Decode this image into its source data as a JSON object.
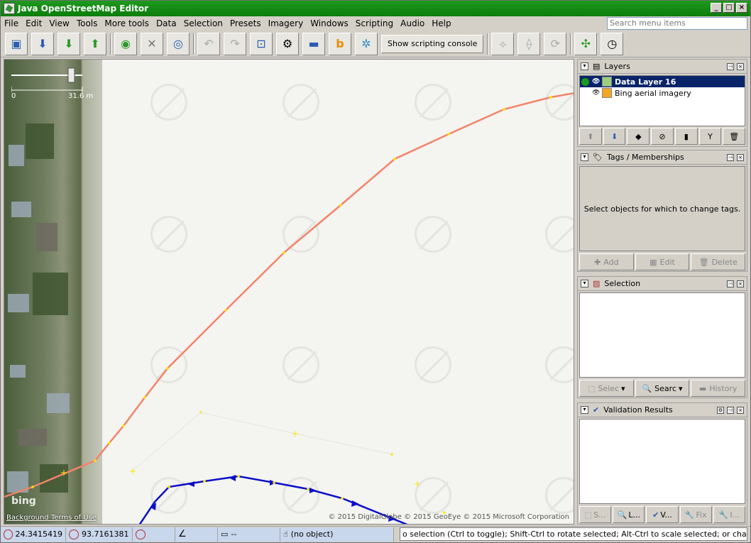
{
  "window": {
    "title": "Java OpenStreetMap Editor"
  },
  "menu": [
    "File",
    "Edit",
    "View",
    "Tools",
    "More tools",
    "Data",
    "Selection",
    "Presets",
    "Imagery",
    "Windows",
    "Scripting",
    "Audio",
    "Help"
  ],
  "search": {
    "placeholder": "Search menu items"
  },
  "toolbar": {
    "script_button_label": "Show scripting console",
    "buttons": [
      "open-icon",
      "save-icon",
      "download-icon",
      "upload-icon",
      "zoom-download-icon",
      "wireframe-icon",
      "search-area-icon",
      "undo-icon",
      "redo-icon",
      "zoom-extent-icon",
      "preferences-icon",
      "layer-swatch-icon",
      "bing-icon",
      "plugin-icon",
      "split-way-icon",
      "combine-way-icon",
      "refresh-icon",
      "zoom-fit-icon",
      "clock-icon"
    ]
  },
  "map": {
    "scale_label_start": "0",
    "scale_label_end": "31.6 m",
    "bing_logo": "bing",
    "attribution": "© 2015 DigitalGlobe © 2015 GeoEye © 2015 Microsoft Corporation",
    "background_terms": "Background Terms of Use"
  },
  "layers_panel": {
    "title": "Layers",
    "items": [
      {
        "label": "Data Layer 16",
        "selected": true
      },
      {
        "label": "Bing aerial imagery",
        "selected": false
      }
    ]
  },
  "tags_panel": {
    "title": "Tags / Memberships",
    "empty_text": "Select objects for which to change tags.",
    "add_label": "Add",
    "edit_label": "Edit",
    "delete_label": "Delete"
  },
  "selection_panel": {
    "title": "Selection",
    "select_label": "Selec",
    "search_label": "Searc",
    "history_label": "History"
  },
  "validation_panel": {
    "title": "Validation Results",
    "btn_s": "S...",
    "btn_l": "L...",
    "btn_v": "V...",
    "btn_fix": "Fix",
    "btn_i": "I..."
  },
  "status": {
    "lat": "24.3415419",
    "lon": "93.7161381",
    "length": "--",
    "object": "(no object)",
    "help": "o selection (Ctrl to toggle); Shift-Ctrl to rotate selected; Alt-Ctrl to scale selected; or change selection"
  }
}
